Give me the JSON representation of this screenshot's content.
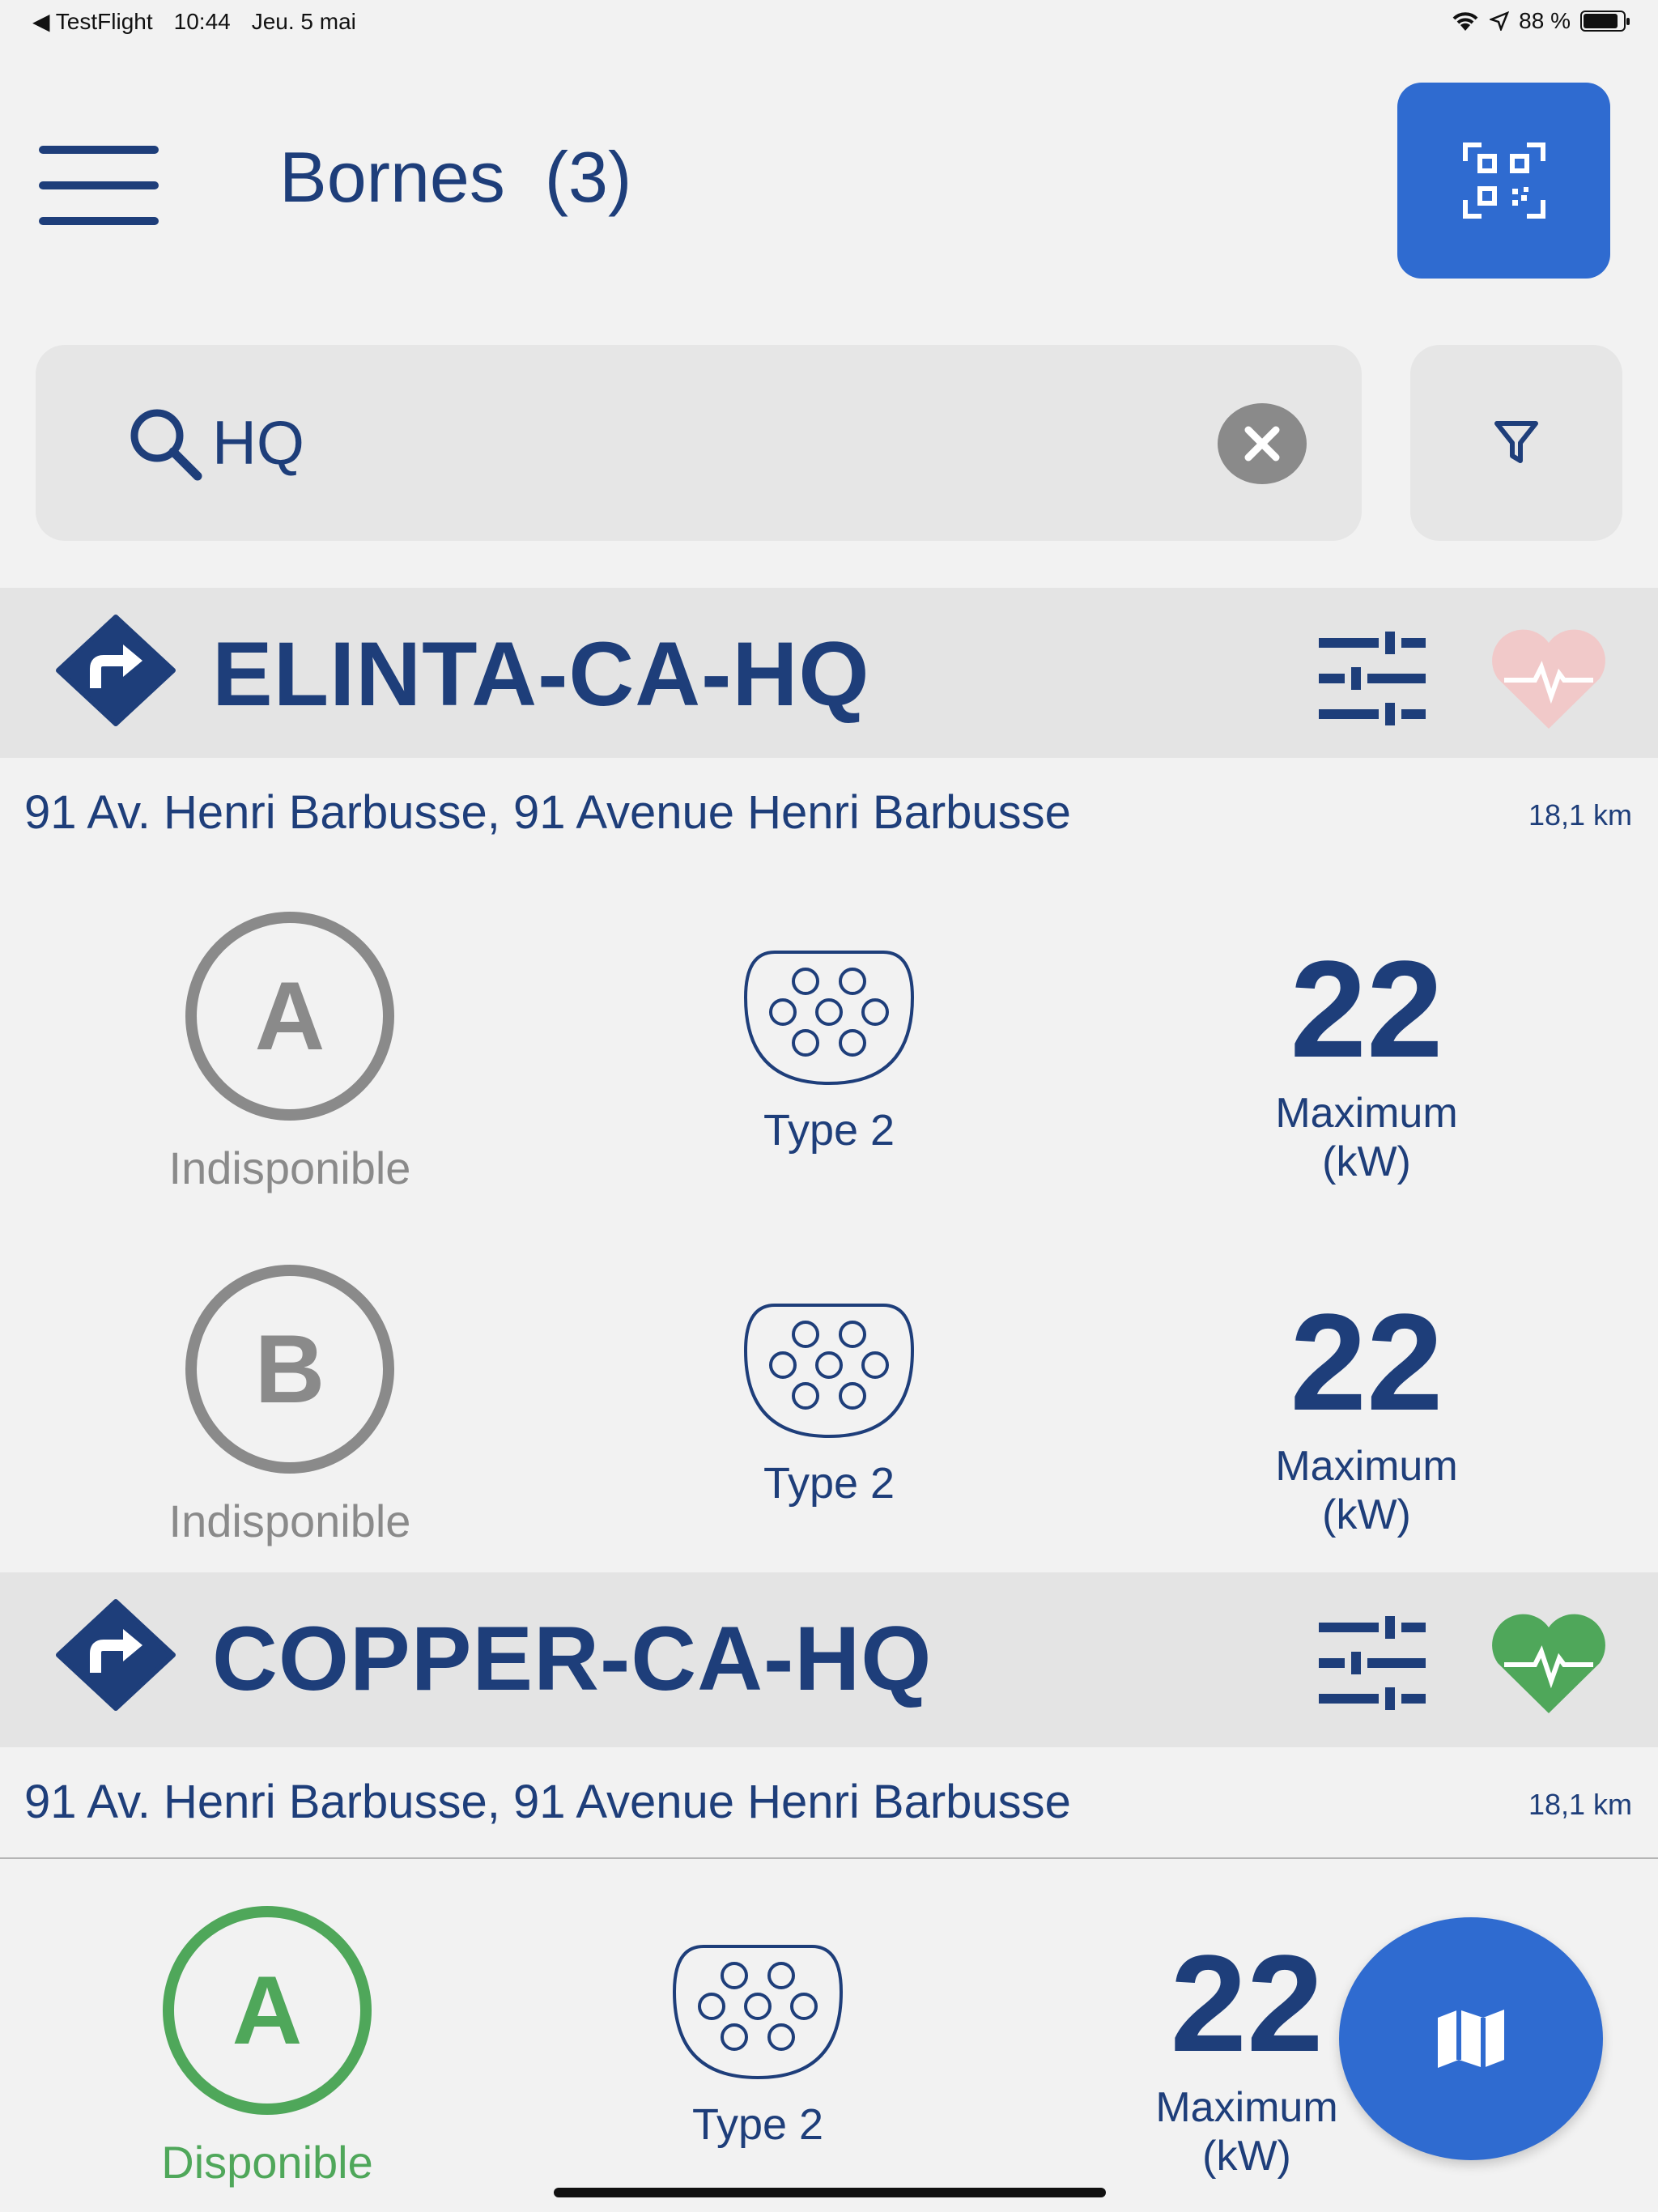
{
  "statusbar": {
    "back_app": "◀ TestFlight",
    "time": "10:44",
    "date": "Jeu. 5 mai",
    "battery": "88 %",
    "battery_level": 0.88
  },
  "header": {
    "title": "Bornes  (3)"
  },
  "search": {
    "value": "HQ"
  },
  "stations": [
    {
      "name": "ELINTA-CA-HQ",
      "address": "91 Av. Henri Barbusse, 91 Avenue Henri Barbusse",
      "distance": "18,1 km",
      "health_color": "#f1c9c9",
      "connectors": [
        {
          "id": "A",
          "status": "Indisponible",
          "type": "Type 2",
          "power": "22",
          "power_label_1": "Maximum",
          "power_label_2": "(kW)"
        },
        {
          "id": "B",
          "status": "Indisponible",
          "type": "Type 2",
          "power": "22",
          "power_label_1": "Maximum",
          "power_label_2": "(kW)"
        }
      ]
    },
    {
      "name": "COPPER-CA-HQ",
      "address": "91 Av. Henri Barbusse, 91 Avenue Henri Barbusse",
      "distance": "18,1 km",
      "health_color": "#4fa75a",
      "connectors": [
        {
          "id": "A",
          "status": "Disponible",
          "type": "Type 2",
          "power": "22",
          "power_label_1": "Maximum",
          "power_label_2": "(kW)"
        }
      ]
    }
  ],
  "colors": {
    "primary": "#1e3e7a",
    "accent": "#2f6bd0",
    "unavailable": "#8a8a8a",
    "available": "#4fa75a"
  },
  "icons": {
    "menu": "hamburger-icon",
    "qr": "qr-code-icon",
    "search": "search-icon",
    "clear": "clear-icon",
    "filter": "filter-icon",
    "direction": "direction-icon",
    "settings": "sliders-icon",
    "health": "heartbeat-icon",
    "connector": "type2-connector-icon",
    "map": "map-icon"
  }
}
